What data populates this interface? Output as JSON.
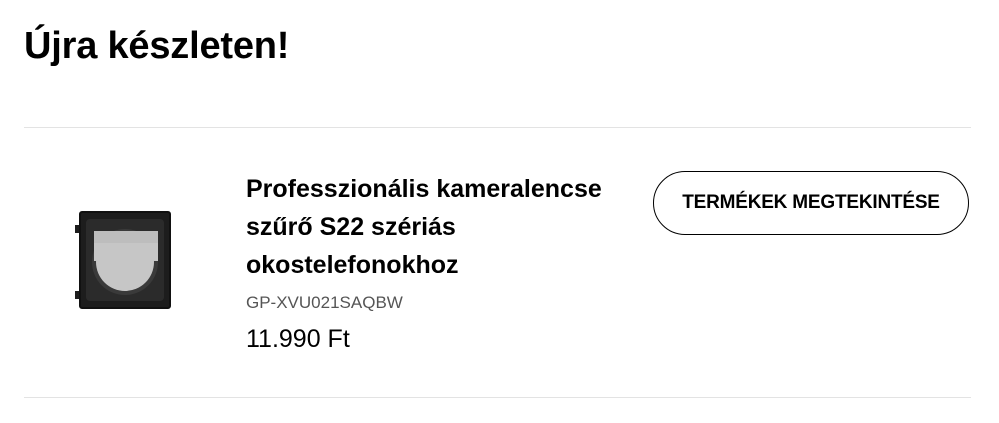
{
  "page": {
    "title": "Újra készleten!"
  },
  "product": {
    "name": "Professzionális kameralencse szűrő S22 szériás okostelefonokhoz",
    "sku": "GP-XVU021SAQBW",
    "price": "11.990 Ft",
    "image_icon": "camera-lens-filter-icon"
  },
  "actions": {
    "view_products_label": "TERMÉKEK MEGTEKINTÉSE"
  }
}
